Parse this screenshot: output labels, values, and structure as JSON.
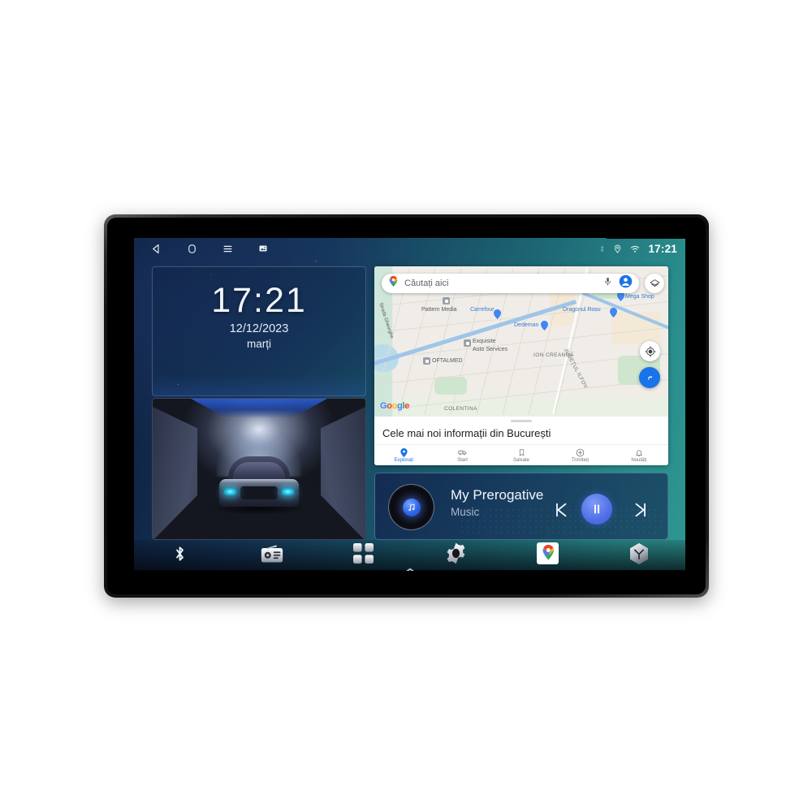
{
  "device": {
    "name": "car-head-unit"
  },
  "statusbar": {
    "nav_icons": [
      {
        "name": "back-icon",
        "label": "Back"
      },
      {
        "name": "home-icon",
        "label": "Home"
      },
      {
        "name": "menu-icon",
        "label": "Menu"
      },
      {
        "name": "screenshot-icon",
        "label": "Screenshot"
      }
    ],
    "status_icons": [
      {
        "name": "bluetooth-icon",
        "label": "Bluetooth"
      },
      {
        "name": "location-icon",
        "label": "Location"
      },
      {
        "name": "wifi-icon",
        "label": "Wi-Fi"
      }
    ],
    "clock": "17:21"
  },
  "clock_widget": {
    "time": "17:21",
    "date": "12/12/2023",
    "weekday": "marți"
  },
  "car_widget": {
    "label": "Car tunnel animation"
  },
  "map": {
    "search_placeholder": "Căutați aici",
    "search_value": "",
    "icons": {
      "pin": "google-maps-pin-icon",
      "mic": "microphone-icon",
      "account": "account-avatar-icon",
      "layers": "layers-icon",
      "mylocation": "my-location-icon",
      "directions": "directions-icon"
    },
    "google_logo": [
      "G",
      "o",
      "o",
      "g",
      "l",
      "e"
    ],
    "labels": [
      {
        "text": "Pattern Media",
        "type": "poi"
      },
      {
        "text": "Carrefour",
        "type": "brand"
      },
      {
        "text": "Dragonul Roșu",
        "type": "brand"
      },
      {
        "text": "Mega Shop",
        "type": "brand"
      },
      {
        "text": "Dedeman",
        "type": "brand"
      },
      {
        "text": "Exquisite",
        "type": "poi"
      },
      {
        "text": "Auto Services",
        "type": "poi"
      },
      {
        "text": "OFTALMED",
        "type": "poi"
      },
      {
        "text": "ION CREANGĂ",
        "type": "area"
      },
      {
        "text": "JUDEȚUL ILFOV",
        "type": "area"
      },
      {
        "text": "COLENTINA",
        "type": "area"
      },
      {
        "text": "Strada Gheorghe",
        "type": "street"
      }
    ],
    "sheet_headline": "Cele mai noi informații din București",
    "tabs": [
      {
        "label": "Explorați",
        "icon": "explore-pin-icon",
        "active": true
      },
      {
        "label": "Start",
        "icon": "commute-icon",
        "active": false
      },
      {
        "label": "Salvate",
        "icon": "bookmark-icon",
        "active": false
      },
      {
        "label": "Trimiteți",
        "icon": "contribute-plus-icon",
        "active": false
      },
      {
        "label": "Noutăți",
        "icon": "bell-icon",
        "active": false
      }
    ]
  },
  "music": {
    "title": "My Prerogative",
    "subtitle": "Music",
    "album_art_icon": "vinyl-record-icon",
    "controls": [
      {
        "name": "previous-track-button",
        "icon": "skip-previous-icon"
      },
      {
        "name": "play-pause-button",
        "icon": "pause-icon"
      },
      {
        "name": "next-track-button",
        "icon": "skip-next-icon"
      }
    ]
  },
  "dock": {
    "items": [
      {
        "name": "dock-bluetooth",
        "label": "Bluetooth",
        "icon": "bluetooth-icon"
      },
      {
        "name": "dock-radio",
        "label": "Radio",
        "icon": "radio-icon"
      },
      {
        "name": "dock-apps",
        "label": "Apps",
        "icon": "app-grid-icon"
      },
      {
        "name": "dock-settings",
        "label": "Settings",
        "icon": "gear-icon"
      },
      {
        "name": "dock-maps",
        "label": "Maps",
        "icon": "google-maps-icon"
      },
      {
        "name": "dock-cube",
        "label": "Navigation",
        "icon": "cube-icon"
      }
    ],
    "drawer_handle": "chevron-up-icon"
  },
  "colors": {
    "accent_blue": "#1a73e8",
    "player_blue": "#4f6fe8",
    "wallpaper_start": "#0d1d3a",
    "wallpaper_end": "#2e9690",
    "map_bg": "#f0ede8"
  }
}
